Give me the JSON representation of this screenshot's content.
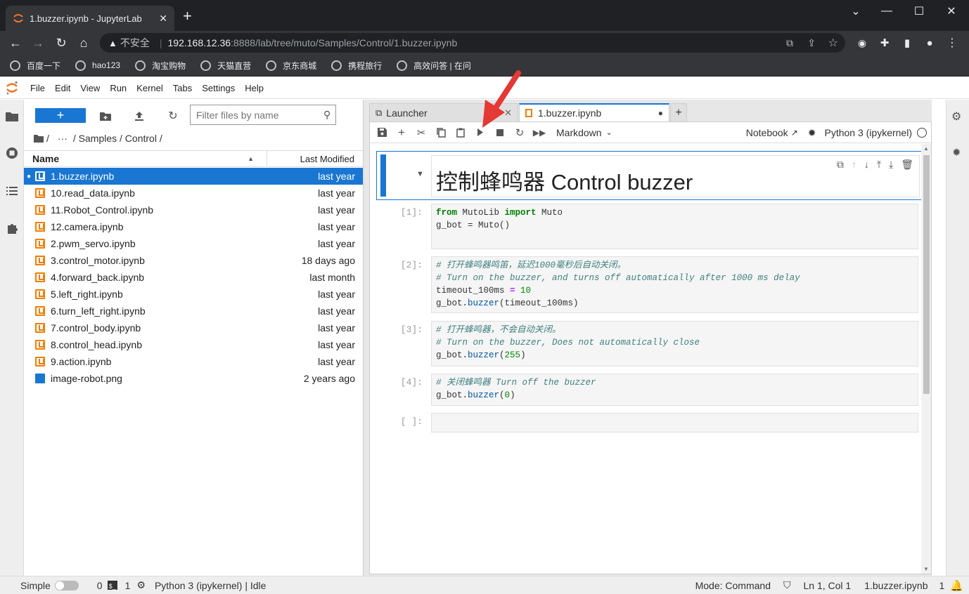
{
  "browser": {
    "tab_title": "1.buzzer.ipynb - JupyterLab",
    "new_tab": "+",
    "security_label": "不安全",
    "url_host": "192.168.12.36",
    "url_rest": ":8888/lab/tree/muto/Samples/Control/1.buzzer.ipynb",
    "bookmarks": [
      "百度一下",
      "hao123",
      "淘宝购物",
      "天猫直营",
      "京东商城",
      "携程旅行",
      "高效问答 | 在问"
    ]
  },
  "menu": [
    "File",
    "Edit",
    "View",
    "Run",
    "Kernel",
    "Tabs",
    "Settings",
    "Help"
  ],
  "filebrowser": {
    "new_label": "+",
    "filter_placeholder": "Filter files by name",
    "crumbs": [
      "/",
      "···",
      "/ Samples / Control /"
    ],
    "col_name": "Name",
    "col_modified": "Last Modified",
    "files": [
      {
        "name": "1.buzzer.ipynb",
        "modified": "last year",
        "selected": true,
        "running": true,
        "kind": "notebook"
      },
      {
        "name": "10.read_data.ipynb",
        "modified": "last year",
        "kind": "notebook"
      },
      {
        "name": "11.Robot_Control.ipynb",
        "modified": "last year",
        "kind": "notebook"
      },
      {
        "name": "12.camera.ipynb",
        "modified": "last year",
        "kind": "notebook"
      },
      {
        "name": "2.pwm_servo.ipynb",
        "modified": "last year",
        "kind": "notebook"
      },
      {
        "name": "3.control_motor.ipynb",
        "modified": "18 days ago",
        "kind": "notebook"
      },
      {
        "name": "4.forward_back.ipynb",
        "modified": "last month",
        "kind": "notebook"
      },
      {
        "name": "5.left_right.ipynb",
        "modified": "last year",
        "kind": "notebook"
      },
      {
        "name": "6.turn_left_right.ipynb",
        "modified": "last year",
        "kind": "notebook"
      },
      {
        "name": "7.control_body.ipynb",
        "modified": "last year",
        "kind": "notebook"
      },
      {
        "name": "8.control_head.ipynb",
        "modified": "last year",
        "kind": "notebook"
      },
      {
        "name": "9.action.ipynb",
        "modified": "last year",
        "kind": "notebook"
      },
      {
        "name": "image-robot.png",
        "modified": "2 years ago",
        "kind": "image"
      }
    ]
  },
  "tabs": {
    "launcher": "Launcher",
    "notebook": "1.buzzer.ipynb",
    "add": "+"
  },
  "toolbar": {
    "cell_type": "Markdown",
    "notebook_label": "Notebook",
    "kernel": "Python 3 (ipykernel)"
  },
  "notebook": {
    "heading": "控制蜂鸣器 Control buzzer",
    "prompts": [
      "[1]:",
      "[2]:",
      "[3]:",
      "[4]:",
      "[ ]:"
    ],
    "c1": {
      "l1a": "from",
      "l1b": " MutoLib ",
      "l1c": "import",
      "l1d": " Muto",
      "l2": "g_bot = Muto()"
    },
    "c2": {
      "l1": "# 打开蜂鸣器鸣笛，延迟1000毫秒后自动关闭。",
      "l2": "# Turn on the buzzer, and turns off automatically after 1000 ms delay",
      "l3a": "timeout_100ms ",
      "l3b": "=",
      "l3c": " 10",
      "l4a": "g_bot.",
      "l4b": "buzzer",
      "l4c": "(timeout_100ms)"
    },
    "c3": {
      "l1": "# 打开蜂鸣器，不会自动关闭。",
      "l2": "# Turn on the buzzer, Does not automatically close",
      "l3a": "g_bot.",
      "l3b": "buzzer",
      "l3c": "(",
      "l3d": "255",
      "l3e": ")"
    },
    "c4": {
      "l1": "# 关闭蜂鸣器 Turn off the buzzer",
      "l2a": "g_bot.",
      "l2b": "buzzer",
      "l2c": "(",
      "l2d": "0",
      "l2e": ")"
    }
  },
  "status": {
    "simple": "Simple",
    "terminals": "0",
    "kernels": "1",
    "kernel_status": "Python 3 (ipykernel) | Idle",
    "mode": "Mode: Command",
    "position": "Ln 1, Col 1",
    "file": "1.buzzer.ipynb",
    "notifications": "1"
  },
  "colors": {
    "accent": "#1976d2",
    "arrow": "#e53935",
    "notebook_icon": "#f57c00"
  }
}
